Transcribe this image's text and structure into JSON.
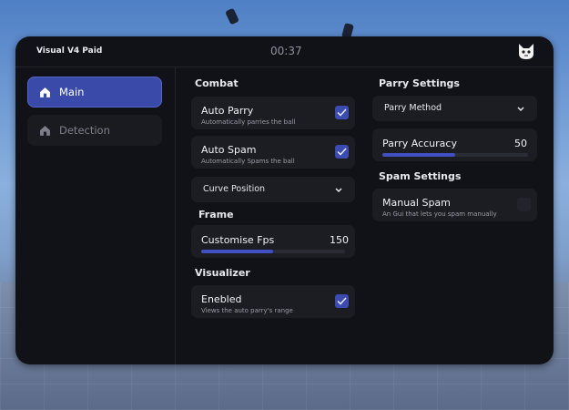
{
  "window": {
    "title": "Visual V4 Paid",
    "timer": "00:37"
  },
  "sidebar": {
    "items": [
      {
        "label": "Main",
        "icon": "home-icon",
        "active": true
      },
      {
        "label": "Detection",
        "icon": "home-icon",
        "active": false
      }
    ]
  },
  "combat": {
    "heading": "Combat",
    "auto_parry": {
      "label": "Auto Parry",
      "desc": "Automatically parries the ball",
      "checked": true
    },
    "auto_spam": {
      "label": "Auto Spam",
      "desc": "Automatically Spams the ball",
      "checked": true
    },
    "curve_position": {
      "label": "Curve Position"
    }
  },
  "frame": {
    "heading": "Frame",
    "customise_fps": {
      "label": "Customise Fps",
      "value": "150",
      "fraction": 0.5
    }
  },
  "visualizer": {
    "heading": "Visualizer",
    "enabled": {
      "label": "Enebled",
      "desc": "Views the auto parry's range",
      "checked": true
    }
  },
  "parry_settings": {
    "heading": "Parry Settings",
    "parry_method": {
      "label": "Parry Method"
    },
    "parry_accuracy": {
      "label": "Parry Accuracy",
      "value": "50",
      "fraction": 0.5
    }
  },
  "spam_settings": {
    "heading": "Spam Settings",
    "manual_spam": {
      "label": "Manual Spam",
      "desc": "An Gui that lets you spam manually",
      "checked": false
    }
  },
  "colors": {
    "accent": "#3b4bb0",
    "panel": "#111217",
    "card": "#1c1d23",
    "nav_active": "#3a4aa8"
  }
}
